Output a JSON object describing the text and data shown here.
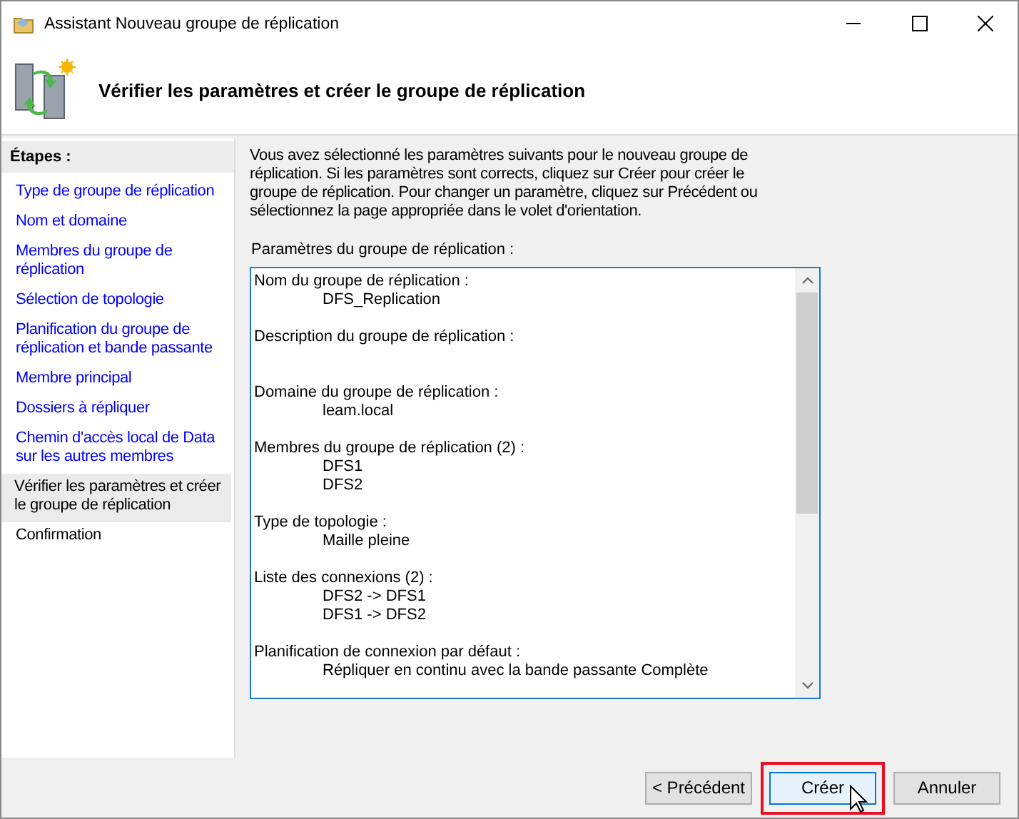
{
  "window": {
    "title": "Assistant Nouveau groupe de réplication"
  },
  "header": {
    "title": "Vérifier les paramètres et créer le groupe de réplication"
  },
  "sidebar": {
    "title": "Étapes :",
    "items": [
      {
        "label": "Type de groupe de réplication",
        "link": true,
        "selected": false
      },
      {
        "label": "Nom et domaine",
        "link": true,
        "selected": false
      },
      {
        "label": "Membres du groupe de réplication",
        "link": true,
        "selected": false
      },
      {
        "label": "Sélection de topologie",
        "link": true,
        "selected": false
      },
      {
        "label": "Planification du groupe de réplication et bande passante",
        "link": true,
        "selected": false
      },
      {
        "label": "Membre principal",
        "link": true,
        "selected": false
      },
      {
        "label": "Dossiers à répliquer",
        "link": true,
        "selected": false
      },
      {
        "label": "Chemin d'accès local de Data sur les autres membres",
        "link": true,
        "selected": false
      },
      {
        "label": "Vérifier les paramètres et créer le groupe de réplication",
        "link": false,
        "selected": true
      },
      {
        "label": "Confirmation",
        "link": false,
        "selected": false
      }
    ]
  },
  "intro": "Vous avez sélectionné les paramètres suivants pour le nouveau groupe de réplication. Si les paramètres sont corrects, cliquez sur Créer pour créer le groupe de réplication. Pour changer un paramètre, cliquez sur Précédent ou sélectionnez la page appropriée dans le volet d'orientation.",
  "settings": {
    "label": "Paramètres du groupe de réplication :",
    "sections": [
      {
        "heading": "Nom du groupe de réplication :",
        "values": [
          "DFS_Replication"
        ]
      },
      {
        "heading": "Description du groupe de réplication :"
      },
      {
        "heading": "Domaine du groupe de réplication :",
        "values": [
          "leam.local"
        ]
      },
      {
        "heading": "Membres du groupe de réplication (2) :",
        "values": [
          "DFS1",
          "DFS2"
        ]
      },
      {
        "heading": "Type de topologie :",
        "values": [
          "Maille pleine"
        ]
      },
      {
        "heading": "Liste des connexions (2) :",
        "values": [
          "DFS2 -> DFS1",
          "DFS1 -> DFS2"
        ]
      },
      {
        "heading": "Planification de connexion par défaut :",
        "values": [
          "Répliquer en continu avec la bande passante Complète"
        ]
      }
    ]
  },
  "buttons": [
    {
      "label": "< Précédent",
      "default": false,
      "highlighted": false
    },
    {
      "label": "Créer",
      "default": true,
      "highlighted": true
    },
    {
      "label": "Annuler",
      "default": false,
      "highlighted": false
    }
  ]
}
